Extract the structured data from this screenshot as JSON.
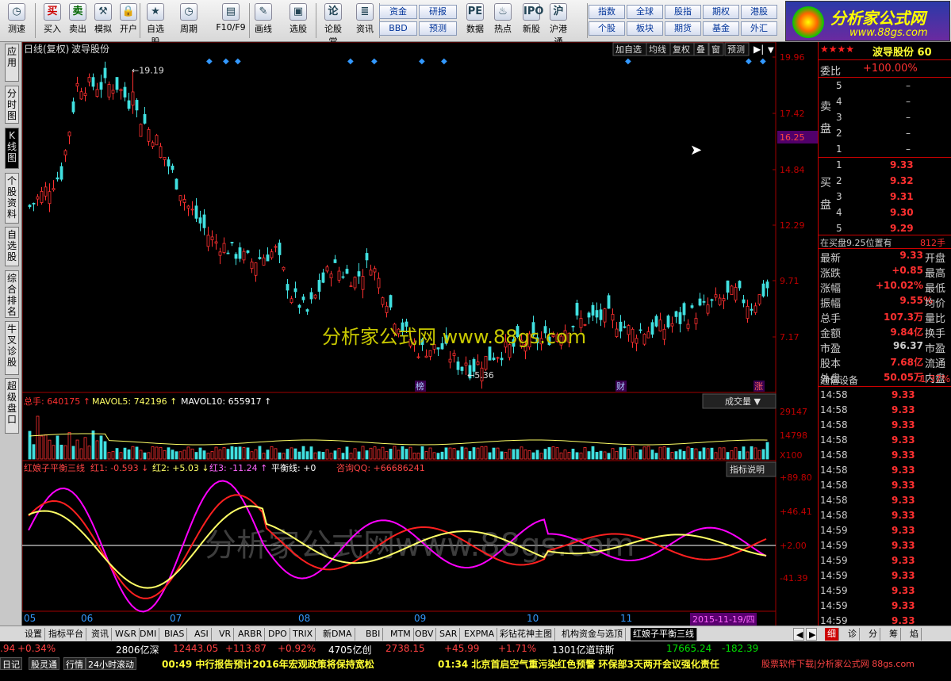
{
  "toolbar": {
    "buttons": [
      {
        "label": "测速",
        "icon": "clock-icon"
      },
      {
        "label": "买入",
        "icon": "buy-icon"
      },
      {
        "label": "卖出",
        "icon": "sell-icon"
      },
      {
        "label": "模拟",
        "icon": "hammer-icon"
      },
      {
        "label": "开户",
        "icon": "lock-icon"
      },
      {
        "label": "自选股",
        "icon": "star-icon"
      },
      {
        "label": "周期",
        "icon": "clock-icon"
      },
      {
        "label": "F10/F9",
        "icon": "document-icon"
      },
      {
        "label": "画线",
        "icon": "pen-icon"
      },
      {
        "label": "选股",
        "icon": "monitor-icon"
      },
      {
        "label": "论股堂",
        "icon": "chat-icon"
      },
      {
        "label": "资讯",
        "icon": "news-icon"
      },
      {
        "label": "数据",
        "icon": "pe-icon"
      },
      {
        "label": "热点",
        "icon": "fire-icon"
      },
      {
        "label": "新股",
        "icon": "ipo-icon"
      },
      {
        "label": "沪港通",
        "icon": "sse-hk-icon"
      }
    ],
    "small": [
      "资金",
      "研报",
      "BBD",
      "预测"
    ],
    "right": [
      "指数",
      "全球",
      "股指",
      "期权",
      "港股",
      "个股",
      "板块",
      "期货",
      "基金",
      "外汇"
    ]
  },
  "logo": {
    "title": "分析家公式网",
    "url": "www.88gs.com"
  },
  "lefttabs": [
    "应用",
    "分时图",
    "K线图",
    "个股资料",
    "自选股",
    "综合排名",
    "牛叉诊股",
    "超级盘口"
  ],
  "main": {
    "title": "日线(复权)",
    "stock": "波导股份",
    "buttons": [
      "加自选",
      "均线",
      "复权",
      "叠",
      "窗",
      "预测"
    ],
    "hi_label": "19.19",
    "lo_label": "5.36",
    "price_axis": [
      "19.96",
      "17.42",
      "14.84",
      "12.29",
      "9.71",
      "7.17"
    ],
    "price_marker": "16.25",
    "markers": [
      "榜",
      "财",
      "涨"
    ],
    "watermark": "分析家公式网 www.88gs.com"
  },
  "volume": {
    "total": "总手: 640175",
    "mavol5": "MAVOL5: 742196",
    "mavol10": "MAVOL10: 655917",
    "menu": "成交量",
    "axis": [
      "29147",
      "14798",
      "X100"
    ]
  },
  "indicator": {
    "name": "红娘子平衡三线",
    "r1": "红1: -0.593",
    "r2": "红2: +5.03",
    "r3": "红3: -11.24",
    "bal": "平衡线: +0",
    "qq": "咨询QQ: +66686241",
    "menu": "指标说明",
    "axis": [
      "+89.80",
      "+46.41",
      "+2.00",
      "-41.39"
    ],
    "watermark": "分析家公式网www.88gs.com"
  },
  "dates": [
    "05",
    "06",
    "07",
    "08",
    "09",
    "10",
    "11"
  ],
  "date_box": "2015-11-19/四",
  "rp": {
    "stars": "★★★★",
    "name": "波导股份 60",
    "weibi_label": "委比",
    "weibi": "+100.00%",
    "sell": [
      {
        "n": "5",
        "p": "–"
      },
      {
        "n": "4",
        "p": "–"
      },
      {
        "n": "3",
        "p": "–"
      },
      {
        "n": "2",
        "p": "–"
      },
      {
        "n": "1",
        "p": "–"
      }
    ],
    "sell_label": "卖盘",
    "buy_label": "买盘",
    "buy": [
      {
        "n": "1",
        "p": "9.33"
      },
      {
        "n": "2",
        "p": "9.32"
      },
      {
        "n": "3",
        "p": "9.31"
      },
      {
        "n": "4",
        "p": "9.30"
      },
      {
        "n": "5",
        "p": "9.29"
      }
    ],
    "zaimai": "在买盘9.25位置有",
    "zaimai_val": "812手",
    "quote": [
      {
        "l": "最新",
        "v": "9.33",
        "l2": "开盘"
      },
      {
        "l": "涨跌",
        "v": "+0.85",
        "l2": "最高"
      },
      {
        "l": "涨幅",
        "v": "+10.02%",
        "l2": "最低"
      },
      {
        "l": "振幅",
        "v": "9.55%",
        "l2": "均价"
      },
      {
        "l": "总手",
        "v": "107.3万",
        "l2": "量比"
      },
      {
        "l": "金额",
        "v": "9.84亿",
        "l2": "换手"
      },
      {
        "l": "市盈",
        "v": "96.37",
        "l2": "市盈"
      },
      {
        "l": "股本",
        "v": "7.68亿",
        "l2": "流通"
      },
      {
        "l": "外盘",
        "v": "50.05万",
        "l2": "内盘"
      }
    ],
    "industry": "通信设备",
    "industry_chg": "1.37%",
    "ticks": [
      {
        "t": "14:58",
        "p": "9.33"
      },
      {
        "t": "14:58",
        "p": "9.33"
      },
      {
        "t": "14:58",
        "p": "9.33"
      },
      {
        "t": "14:58",
        "p": "9.33"
      },
      {
        "t": "14:58",
        "p": "9.33"
      },
      {
        "t": "14:58",
        "p": "9.33"
      },
      {
        "t": "14:58",
        "p": "9.33"
      },
      {
        "t": "14:58",
        "p": "9.33"
      },
      {
        "t": "14:58",
        "p": "9.33"
      },
      {
        "t": "14:59",
        "p": "9.33"
      },
      {
        "t": "14:59",
        "p": "9.33"
      },
      {
        "t": "14:59",
        "p": "9.33"
      },
      {
        "t": "14:59",
        "p": "9.33"
      },
      {
        "t": "14:59",
        "p": "9.33"
      },
      {
        "t": "14:59",
        "p": "9.33"
      },
      {
        "t": "14:59",
        "p": "9.33"
      }
    ],
    "tabs": [
      "细",
      "诊",
      "分",
      "筹",
      "焰"
    ]
  },
  "bottom_tabs": [
    "设置",
    "指标平台",
    "资讯",
    "W&R",
    "DMI",
    "BIAS",
    "ASI",
    "VR",
    "ARBR",
    "DPO",
    "TRIX",
    "新DMA",
    "BBI",
    "MTM",
    "OBV",
    "SAR",
    "EXPMA",
    "彩钻花神主图",
    "机构资金与选顶",
    "红娘子平衡三线"
  ],
  "status": {
    "row1": [
      {
        "t": ".94",
        "c": "#ff4040"
      },
      {
        "t": "+0.34%",
        "c": "#ff4040"
      },
      {
        "t": "2806亿深",
        "c": "#fff"
      },
      {
        "t": "12443.05",
        "c": "#ff4040"
      },
      {
        "t": "+113.87",
        "c": "#ff4040"
      },
      {
        "t": "+0.92%",
        "c": "#ff4040"
      },
      {
        "t": "4705亿创",
        "c": "#fff"
      },
      {
        "t": "2738.15",
        "c": "#ff4040"
      },
      {
        "t": "+45.99",
        "c": "#ff4040"
      },
      {
        "t": "+1.71%",
        "c": "#ff4040"
      },
      {
        "t": "1301亿道琼斯",
        "c": "#fff"
      },
      {
        "t": "17665.24",
        "c": "#00e000"
      },
      {
        "t": "-182.39",
        "c": "#00e000"
      }
    ],
    "row2_btns": [
      "日记",
      "股灵通",
      "行情",
      "24小时滚动"
    ],
    "news1": "00:49 中行报告预计2016年宏观政策将保持宽松",
    "news2": "01:34 北京首启空气重污染红色预警 环保部3天两开会议强化责任",
    "ad": "股票软件下载|分析家公式网 88gs.com"
  },
  "chart_data": {
    "type": "candlestick",
    "x": [
      "05",
      "06",
      "07",
      "08",
      "09",
      "10",
      "11"
    ],
    "price_range": [
      5.36,
      19.96
    ],
    "ohlc_samples": [
      [
        13.0,
        14.5,
        12.5,
        14.2
      ],
      [
        15.5,
        19.19,
        15.0,
        18.0
      ],
      [
        17.0,
        17.6,
        14.0,
        14.5
      ],
      [
        12.0,
        12.8,
        9.5,
        10.0
      ],
      [
        8.5,
        10.5,
        8.2,
        10.2
      ],
      [
        7.0,
        7.5,
        5.36,
        6.0
      ],
      [
        7.5,
        8.2,
        7.3,
        8.0
      ],
      [
        8.5,
        9.4,
        8.2,
        9.33
      ]
    ]
  }
}
